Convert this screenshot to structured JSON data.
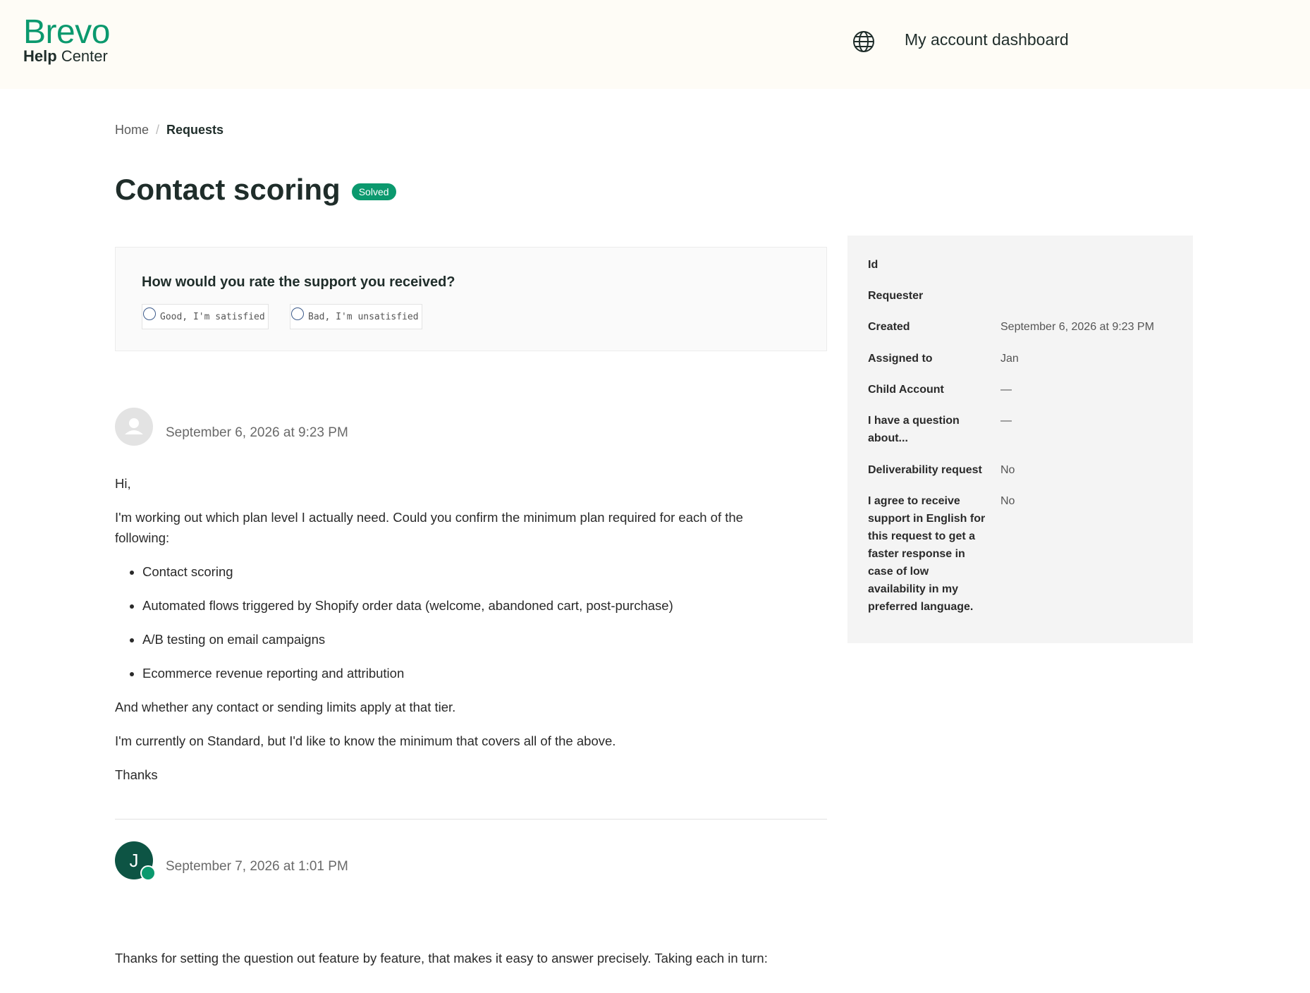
{
  "header": {
    "brand": "Brevo",
    "sub_bold": "Help",
    "sub_rest": "Center",
    "dashboard_link": "My account dashboard"
  },
  "breadcrumb": {
    "home": "Home",
    "separator": "/",
    "current": "Requests"
  },
  "request": {
    "title": "Contact scoring",
    "status": "Solved",
    "status_color": "#0b996e"
  },
  "rating": {
    "question": "How would you rate the support you received?",
    "good": "Good, I'm satisfied",
    "bad": "Bad, I'm unsatisfied"
  },
  "details": [
    {
      "key": "Id",
      "value": ""
    },
    {
      "key": "Requester",
      "value": ""
    },
    {
      "key": "Created",
      "value": "September 6, 2026 at 9:23 PM"
    },
    {
      "key": "Assigned to",
      "value": "Jan"
    },
    {
      "key": "Child Account",
      "value": "—"
    },
    {
      "key": "I have a question about...",
      "value": "—"
    },
    {
      "key": "Deliverability request",
      "value": "No"
    },
    {
      "key": "I agree to receive support in English for this request to get a faster response in case of low availability in my preferred language.",
      "value": "No"
    }
  ],
  "messages": [
    {
      "date": "September 6, 2026 at 9:23 PM",
      "greeting": "Hi,",
      "intro": "I'm working out which plan level I actually need. Could you confirm the minimum plan required for each of the following:",
      "items": [
        "Contact scoring",
        "Automated flows triggered by Shopify order data (welcome, abandoned cart, post-purchase)",
        "A/B testing on email campaigns",
        "Ecommerce revenue reporting and attribution"
      ],
      "p2": "And whether any contact or sending limits apply at that tier.",
      "p3": "I'm currently on Standard, but I'd like to know the minimum that covers all of the above.",
      "closing": "Thanks"
    },
    {
      "initial": "J",
      "date": "September 7, 2026 at 1:01 PM",
      "body": "Thanks for setting the question out feature by feature, that makes it easy to answer precisely. Taking each in turn:"
    }
  ]
}
